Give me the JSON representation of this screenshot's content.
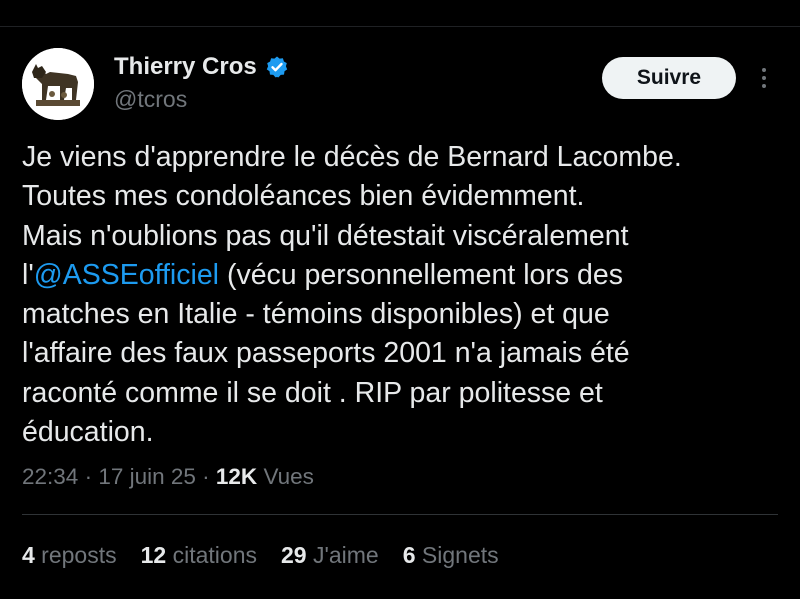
{
  "author": {
    "display_name": "Thierry Cros",
    "handle": "@tcros",
    "verified": true,
    "avatar_icon": "wolf-statue-avatar"
  },
  "actions": {
    "follow_label": "Suivre",
    "more_icon": "more-vertical-icon"
  },
  "tweet": {
    "lines": [
      "Je viens d'apprendre le décès de Bernard Lacombe.",
      "Toutes mes condoléances bien évidemment.",
      "Mais n'oublions pas qu'il détestait viscéralement",
      "matches en Italie - témoins disponibles) et que",
      "l'affaire des faux passeports 2001 n'a jamais été",
      "raconté comme il se doit . RIP par politesse et",
      "éducation."
    ],
    "line4_prefix": "l'",
    "mention": "@ASSEofficiel",
    "line4_suffix": " (vécu personnellement lors des"
  },
  "meta": {
    "time": "22:34",
    "sep1": " · ",
    "date": "17 juin 25",
    "sep2": " · ",
    "views_count": "12K",
    "views_label": " Vues"
  },
  "stats": {
    "reposts_count": "4",
    "reposts_label": " reposts",
    "quotes_count": "12",
    "quotes_label": " citations",
    "likes_count": "29",
    "likes_label": " J'aime",
    "bookmarks_count": "6",
    "bookmarks_label": " Signets"
  },
  "colors": {
    "background": "#000000",
    "text": "#e7e9ea",
    "secondary": "#71767b",
    "accent": "#1d9bf0"
  }
}
